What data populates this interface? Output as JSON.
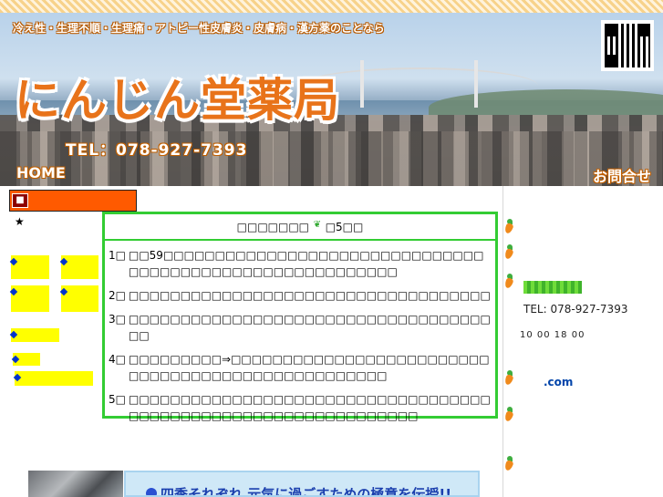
{
  "header": {
    "tagline": "冷え性・生理不順・生理痛・アトピー性皮膚炎・皮膚病・漢方薬のことなら",
    "logo": "にんじん堂薬局",
    "tel": "TEL：078-927-7393",
    "home": "HOME",
    "contact": "お問合せ"
  },
  "left": {
    "star": "★"
  },
  "panel": {
    "title_left": "□□□□□□□",
    "title_right": "□5□□",
    "items": [
      {
        "num": "1□",
        "text": "□□59□□□□□□□□□□□□□□□□□□□□□□□□□□□□□□□□□□□□□□□□□□□□□□□□□□□□□□□□□"
      },
      {
        "num": "2□",
        "text": "□□□□□□□□□□□□□□□□□□□□□□□□□□□□□□□□□□□"
      },
      {
        "num": "3□",
        "text": "□□□□□□□□□□□□□□□□□□□□□□□□□□□□□□□□□□□□□"
      },
      {
        "num": "4□",
        "text": "□□□□□□□□□⇒□□□□□□□□□□□□□□□□□□□□□□□□□□□□□□□□□□□□□□□□□□□□□□□□□□"
      },
      {
        "num": "5□",
        "text": "□□□□□□□□□□□□□□□□□□□□□□□□□□□□□□□□□□□□□□□□□□□□□□□□□□□□□□□□□□□□□□□"
      }
    ]
  },
  "right": {
    "tel": "TEL: 078-927-7393",
    "hours": "10 00 18 00",
    "domain": ".com"
  },
  "bottom": {
    "banner_text": "四季それぞれ 元気に過ごすための極意を伝授!!"
  },
  "colors": {
    "accent": "#ff5a00",
    "panel_border": "#33cc33",
    "link_yellow": "#ffff00",
    "bullet_blue": "#0033cc"
  }
}
